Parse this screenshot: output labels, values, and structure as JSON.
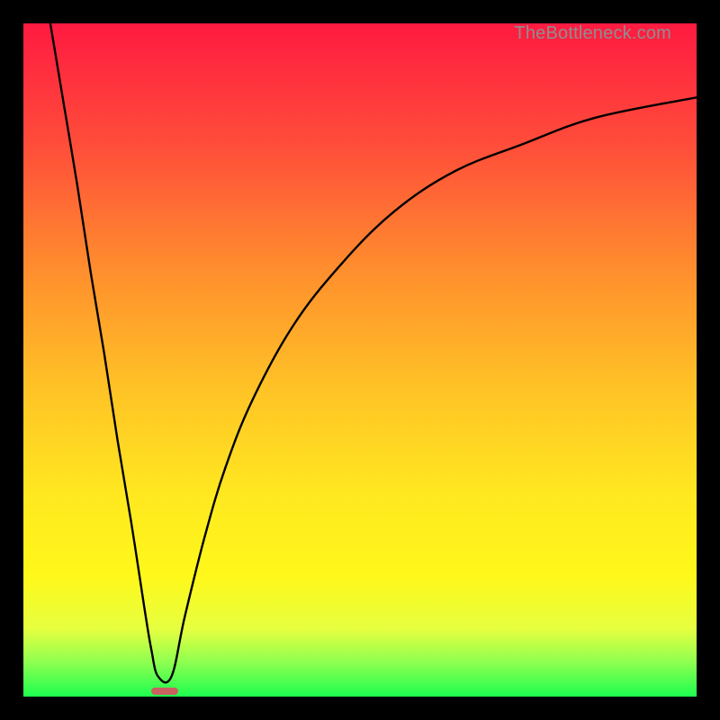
{
  "watermark": "TheBottleneck.com",
  "colors": {
    "frame": "#000000",
    "curve": "#000000",
    "marker": "#c96161",
    "gradient_stops": [
      "#ff1a41",
      "#ff4d3a",
      "#ff8c2e",
      "#ffc226",
      "#ffe820",
      "#fff81a",
      "#e6ff40",
      "#8cff50",
      "#1cff50"
    ]
  },
  "chart_data": {
    "type": "line",
    "title": "",
    "xlabel": "",
    "ylabel": "",
    "xlim": [
      0,
      100
    ],
    "ylim": [
      0,
      100
    ],
    "series": [
      {
        "name": "left-branch",
        "x": [
          4,
          6,
          8,
          10,
          12,
          14,
          16,
          18,
          19,
          20
        ],
        "values": [
          100,
          88,
          76,
          63,
          51,
          38,
          26,
          13,
          7,
          3
        ]
      },
      {
        "name": "right-branch",
        "x": [
          22,
          24,
          27,
          30,
          34,
          40,
          47,
          55,
          64,
          74,
          85,
          100
        ],
        "values": [
          3,
          12,
          24,
          34,
          44,
          55,
          64,
          72,
          78,
          82,
          86,
          89
        ]
      }
    ],
    "annotations": [
      {
        "name": "min-marker",
        "x": 21,
        "y": 0.8,
        "w": 4,
        "h": 1.2
      }
    ]
  }
}
